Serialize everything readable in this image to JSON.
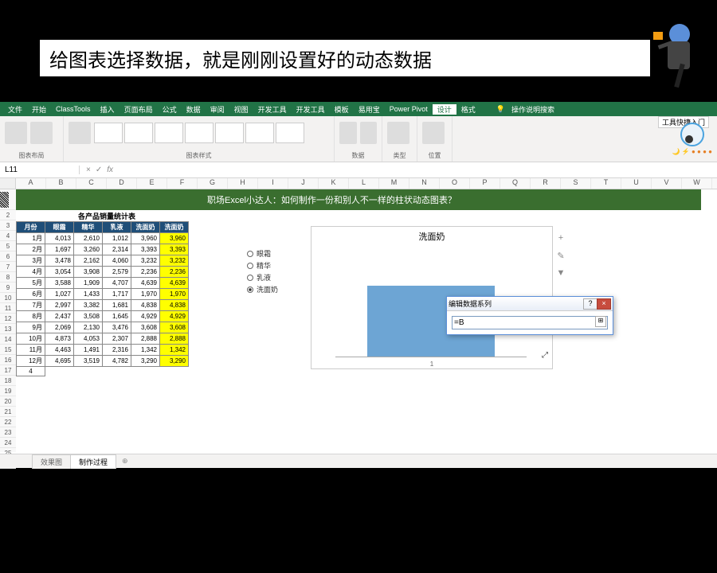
{
  "caption": "给图表选择数据，就是刚刚设置好的动态数据",
  "ribbon": {
    "tabs": [
      "文件",
      "开始",
      "ClassTools",
      "插入",
      "页面布局",
      "公式",
      "数据",
      "审阅",
      "视图",
      "开发工具",
      "开发工具",
      "模板",
      "易用宝",
      "Power Pivot",
      "设计",
      "格式"
    ],
    "active_tab": "设计",
    "help_hint": "操作说明搜索",
    "groups": {
      "layout": "图表布局",
      "styles": "图表样式",
      "data": "数据",
      "type": "类型",
      "location": "位置"
    },
    "toolkit": "工具快捷入门",
    "assistant_icons": "🌙 ⚡ ● ● ● ●"
  },
  "namebox": "L11",
  "fx": {
    "cancel": "×",
    "enter": "✓",
    "fn": "fx"
  },
  "columns": [
    "A",
    "B",
    "C",
    "D",
    "E",
    "F",
    "G",
    "H",
    "I",
    "J",
    "K",
    "L",
    "M",
    "N",
    "O",
    "P",
    "Q",
    "R",
    "S",
    "T",
    "U",
    "V",
    "W"
  ],
  "banner_text": "职场Excel小达人：如何制作一份和别人不一样的柱状动态图表？",
  "table_title": "各产品销量统计表",
  "table": {
    "headers": [
      "月份",
      "眼霜",
      "精华",
      "乳液",
      "洗面奶",
      "洗面奶"
    ],
    "rows": [
      [
        "1月",
        "4,013",
        "2,610",
        "1,012",
        "3,960",
        "3,960"
      ],
      [
        "2月",
        "1,697",
        "3,260",
        "2,314",
        "3,393",
        "3,393"
      ],
      [
        "3月",
        "3,478",
        "2,162",
        "4,060",
        "3,232",
        "3,232"
      ],
      [
        "4月",
        "3,054",
        "3,908",
        "2,579",
        "2,236",
        "2,236"
      ],
      [
        "5月",
        "3,588",
        "1,909",
        "4,707",
        "4,639",
        "4,639"
      ],
      [
        "6月",
        "1,027",
        "1,433",
        "1,717",
        "1,970",
        "1,970"
      ],
      [
        "7月",
        "2,997",
        "3,382",
        "1,681",
        "4,838",
        "4,838"
      ],
      [
        "8月",
        "2,437",
        "3,508",
        "1,645",
        "4,929",
        "4,929"
      ],
      [
        "9月",
        "2,069",
        "2,130",
        "3,476",
        "3,608",
        "3,608"
      ],
      [
        "10月",
        "4,873",
        "4,053",
        "2,307",
        "2,888",
        "2,888"
      ],
      [
        "11月",
        "4,463",
        "1,491",
        "2,316",
        "1,342",
        "1,342"
      ],
      [
        "12月",
        "4,695",
        "3,519",
        "4,782",
        "3,290",
        "3,290"
      ]
    ],
    "extra_row": "4"
  },
  "slicer": {
    "options": [
      "眼霜",
      "精华",
      "乳液",
      "洗面奶"
    ],
    "selected": "洗面奶"
  },
  "chart": {
    "title": "洗面奶",
    "x_label": "1",
    "tools": [
      "+",
      "✎",
      "▼"
    ]
  },
  "chart_data": {
    "type": "bar",
    "categories": [
      "1"
    ],
    "values": [
      3960
    ],
    "title": "洗面奶",
    "xlabel": "",
    "ylabel": "",
    "ylim": [
      0,
      6000
    ]
  },
  "dialog": {
    "title": "编辑数据系列",
    "value": "=B",
    "close": "×",
    "help": "?"
  },
  "sheets": {
    "tab1": "效果图",
    "tab2": "制作过程",
    "plus": "⊕"
  }
}
